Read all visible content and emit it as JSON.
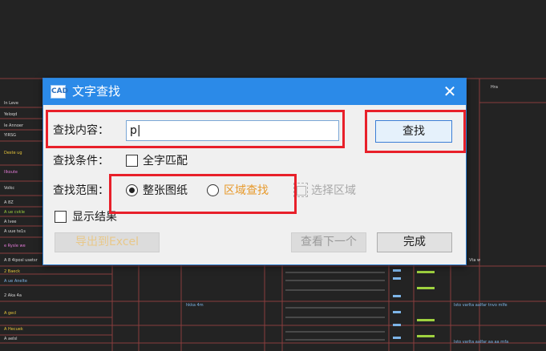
{
  "background": {
    "left_column_labels": [
      "ln Leve",
      "Yeloqd",
      "le Annoer",
      "YIRSG",
      "Deste ug",
      "IIkoute",
      "Volkc",
      "A 8Z",
      "A ue cvkle",
      "A lvee",
      "A uue te1s",
      "e Rysle we",
      "A 8 4iposl usetsr",
      "2 Baeck",
      "A ue Anelte",
      "2 Aka 4a",
      "A gecl",
      "A Hecuek",
      "A aelsl"
    ],
    "right_labels": [
      "Hra",
      "Vta w",
      "hkka 4m",
      "Isto varlta aalfar tnvo mlfe",
      "Isto varlta aalfar aa aa rnfa"
    ]
  },
  "dialog": {
    "title": "文字查找",
    "app_icon_text": "CAD",
    "close_symbol": "✕",
    "search_label": "查找内容：",
    "search_value": "p|",
    "find_button": "查找",
    "condition_label": "查找条件：",
    "whole_word_label": "全字匹配",
    "whole_word_checked": false,
    "scope_label": "查找范围：",
    "scope_options": [
      {
        "label": "整张图纸",
        "selected": true
      },
      {
        "label": "区域查找",
        "selected": false
      }
    ],
    "select_area_label": "选择区域",
    "show_result_label": "显示结果",
    "show_result_checked": false,
    "export_button": "导出到Excel",
    "find_next_button": "查看下一个",
    "done_button": "完成"
  },
  "colors": {
    "titlebar": "#2b8ae8",
    "annotation_red": "#e8202a",
    "area_search_orange": "#e79a2c",
    "background": "#232323"
  }
}
